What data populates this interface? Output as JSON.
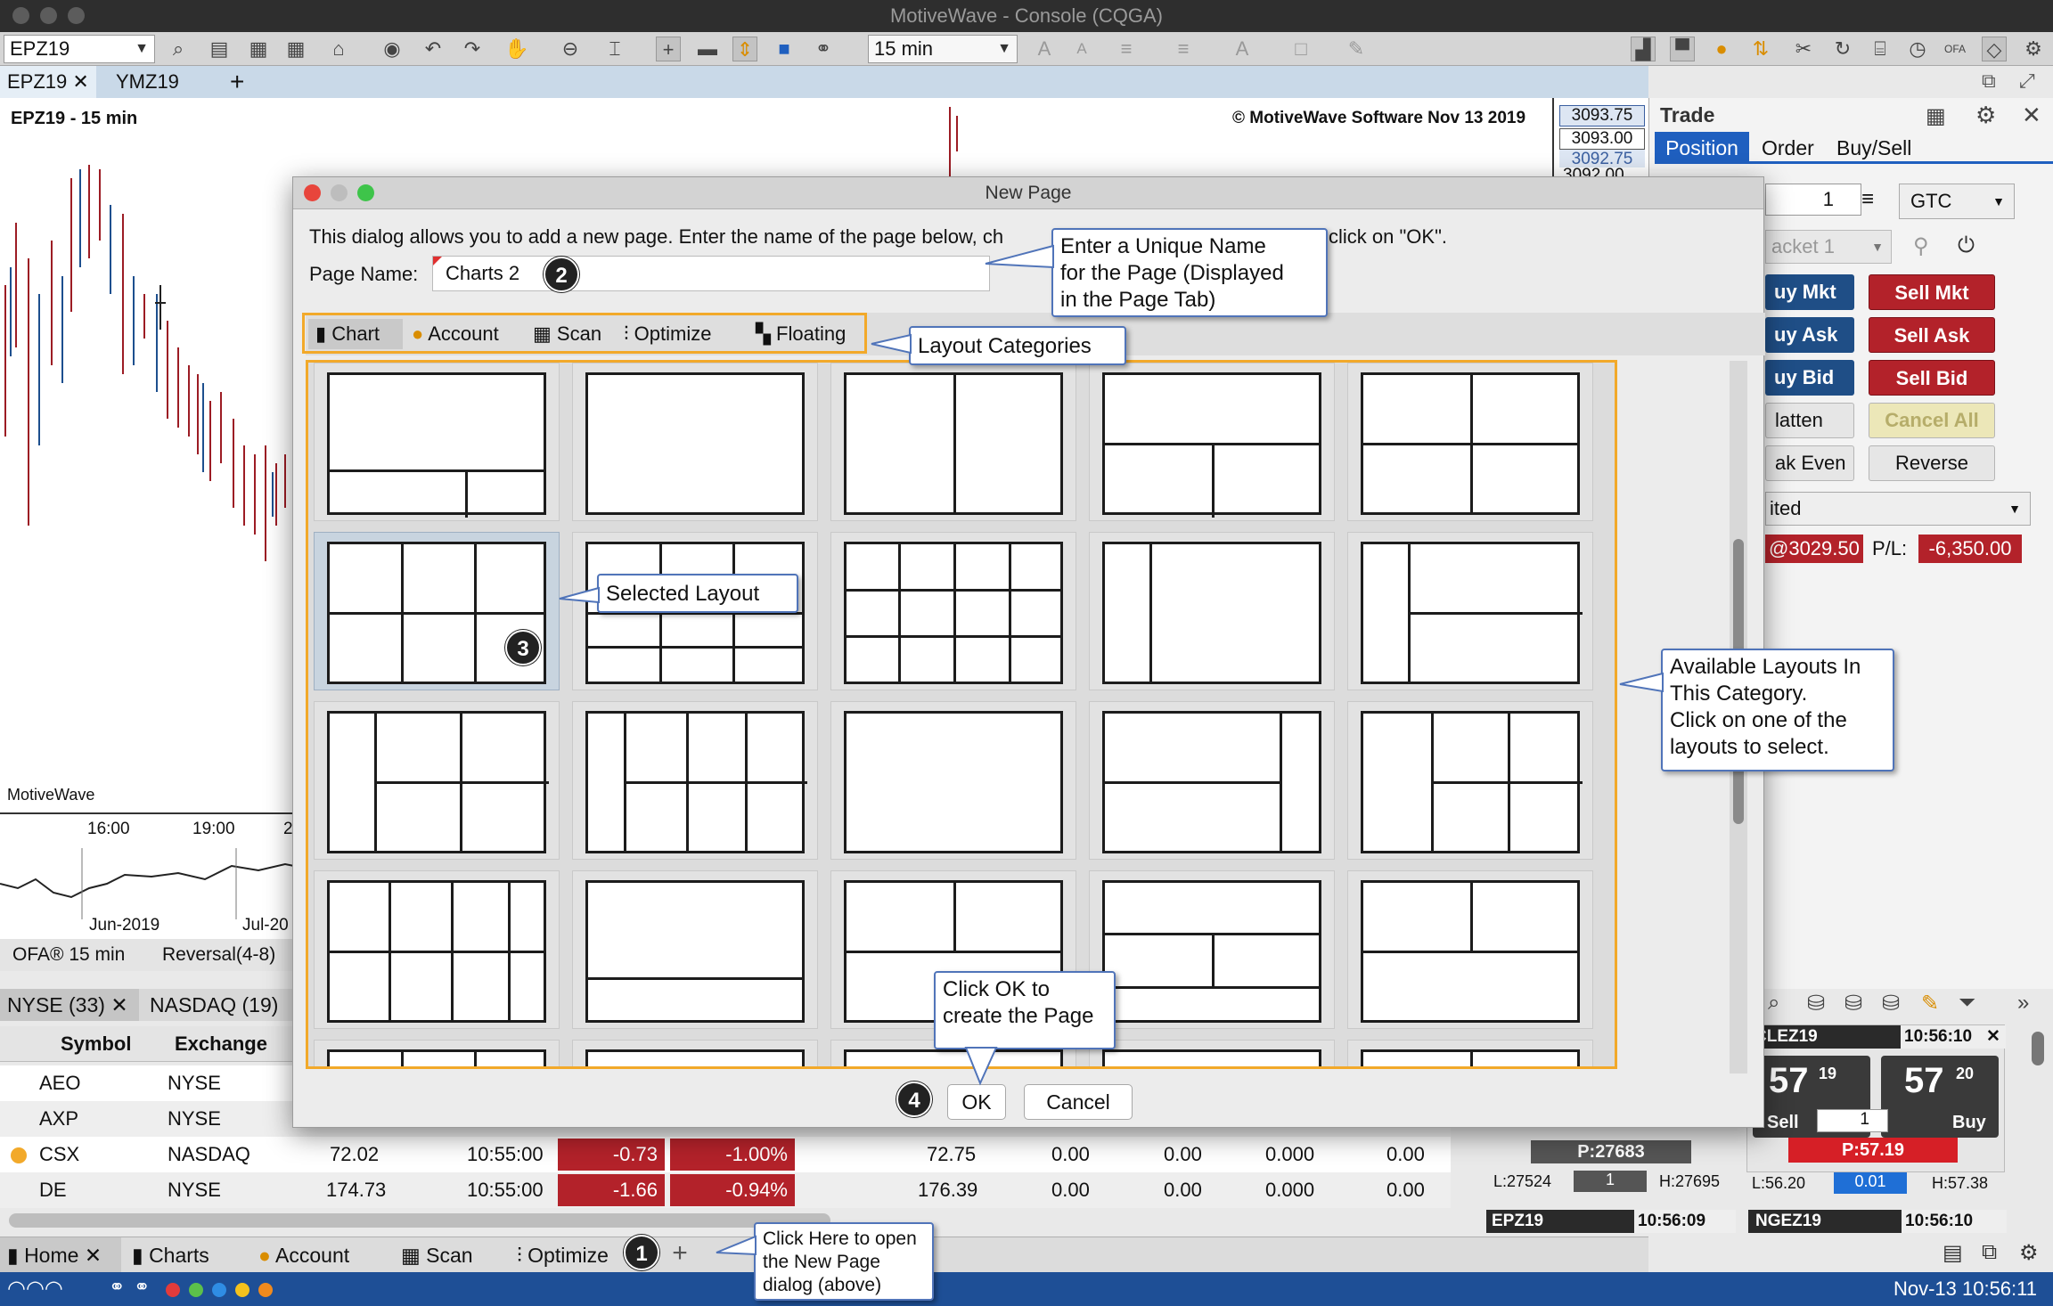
{
  "window": {
    "title": "MotiveWave - Console (CQGA)"
  },
  "toolbar": {
    "symbol": "EPZ19",
    "timeframe": "15 min"
  },
  "tabs": [
    {
      "label": "EPZ19"
    },
    {
      "label": "YMZ19"
    }
  ],
  "chart": {
    "title": "EPZ19 - 15 min",
    "copyright": "© MotiveWave Software Nov 13 2019",
    "watermark": "MotiveWave",
    "times": [
      "16:00",
      "19:00",
      "2"
    ],
    "prices": [
      "3093.75",
      "3093.00",
      "3092.75",
      "3092.00"
    ],
    "mini_dates": [
      "Jun-2019",
      "Jul-20"
    ],
    "study1": "OFA® 15 min",
    "study2": "Reversal(4-8)"
  },
  "trade_panel": {
    "title": "Trade",
    "tabs": [
      "Position",
      "Order",
      "Buy/Sell"
    ],
    "qty": "1",
    "tif": "GTC",
    "bracket": "acket 1",
    "buy_mkt": "uy Mkt",
    "sell_mkt": "Sell Mkt",
    "buy_ask": "uy Ask",
    "sell_ask": "Sell Ask",
    "buy_bid": "uy Bid",
    "sell_bid": "Sell Bid",
    "flatten": "latten",
    "cancel_all": "Cancel All",
    "break_even": "ak Even",
    "reverse": "Reverse",
    "account_combo": "ited",
    "position_price": "@3029.50",
    "pl_label": "P/L:",
    "pl_value": "-6,350.00"
  },
  "watchlist": {
    "tabs": [
      "NYSE (33)",
      "NASDAQ (19)"
    ],
    "columns": [
      "Symbol",
      "Exchange"
    ],
    "rows": [
      {
        "symbol": "AEO",
        "exchange": "NYSE"
      },
      {
        "symbol": "AXP",
        "exchange": "NYSE"
      },
      {
        "symbol": "CSX",
        "exchange": "NASDAQ",
        "last": "72.02",
        "time": "10:55:00",
        "chg": "-0.73",
        "pct": "-1.00%",
        "open": "72.75",
        "c1": "0.00",
        "c2": "0.00",
        "c3": "0.000",
        "c4": "0.00"
      },
      {
        "symbol": "DE",
        "exchange": "NYSE",
        "last": "174.73",
        "time": "10:55:00",
        "chg": "-1.66",
        "pct": "-0.94%",
        "open": "176.39",
        "c1": "0.00",
        "c2": "0.00",
        "c3": "0.000",
        "c4": "0.00"
      }
    ]
  },
  "dom": {
    "symbol1": "CLEZ19",
    "time1": "10:56:10",
    "sell_price": "57",
    "sell_sup": "19",
    "buy_price": "57",
    "buy_sup": "20",
    "sell_label": "Sell",
    "buy_label": "Buy",
    "qty": "1",
    "p_left": "P:27683",
    "l_left": "L:27524",
    "qty_left": "1",
    "h_left": "H:27695",
    "p_right": "P:57.19",
    "l_right": "L:56.20",
    "qty_right": "0.01",
    "h_right": "H:57.38",
    "symbol2": "EPZ19",
    "time2": "10:56:09",
    "symbol3": "NGEZ19",
    "time3": "10:56:10"
  },
  "bottom_tabs": [
    "Home",
    "Charts",
    "Account",
    "Scan",
    "Optimize"
  ],
  "status": {
    "datetime": "Nov-13 10:56:11",
    "colors": [
      "#e23b3b",
      "#5cc04a",
      "#2f8de4",
      "#f4c21d",
      "#f08a1d"
    ]
  },
  "dialog": {
    "title": "New Page",
    "intro_a": "This dialog allows you to add a new page.  Enter the name of the page below, ch",
    "intro_b": "click on \"OK\".",
    "name_label": "Page Name:",
    "name_value": "Charts 2",
    "categories": [
      "Chart",
      "Account",
      "Scan",
      "Optimize",
      "Floating"
    ],
    "ok": "OK",
    "cancel": "Cancel"
  },
  "callouts": {
    "name": [
      "Enter a Unique Name",
      "for the Page (Displayed",
      "in the Page Tab)"
    ],
    "categories": "Layout Categories",
    "selected": "Selected Layout",
    "available": [
      "Available Layouts In",
      "This Category.",
      "Click on one of the",
      "layouts to select."
    ],
    "ok": [
      "Click OK to",
      "create the Page"
    ],
    "plus": [
      "Click Here to open",
      "the New Page",
      "dialog (above)"
    ]
  },
  "steps": [
    "1",
    "2",
    "3",
    "4"
  ]
}
